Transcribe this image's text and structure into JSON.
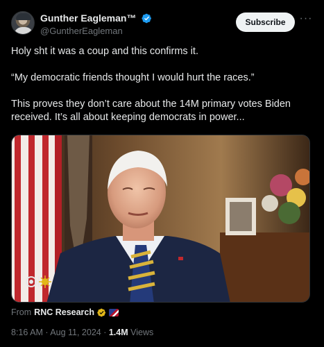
{
  "author": {
    "display_name": "Gunther Eagleman™",
    "handle": "@GuntherEagleman"
  },
  "actions": {
    "subscribe_label": "Subscribe",
    "more_label": "···"
  },
  "tweet": {
    "line1": "Holy sht it was a coup and this confirms it.",
    "line2": "“My democratic friends thought I would hurt the races.”",
    "line3": "This proves they don’t care about the 14M primary votes Biden",
    "line4": "received. It’s all about keeping democrats in power..."
  },
  "attribution": {
    "prefix": "From",
    "source": "RNC Research"
  },
  "meta": {
    "timestamp": "8:16 AM · Aug 11, 2024 · ",
    "views_count": "1.4M",
    "views_label": " Views"
  },
  "colors": {
    "background": "#000000",
    "verified_blue": "#1d9bf0",
    "gold_badge": "#e2b719",
    "muted_text": "#71767b"
  }
}
